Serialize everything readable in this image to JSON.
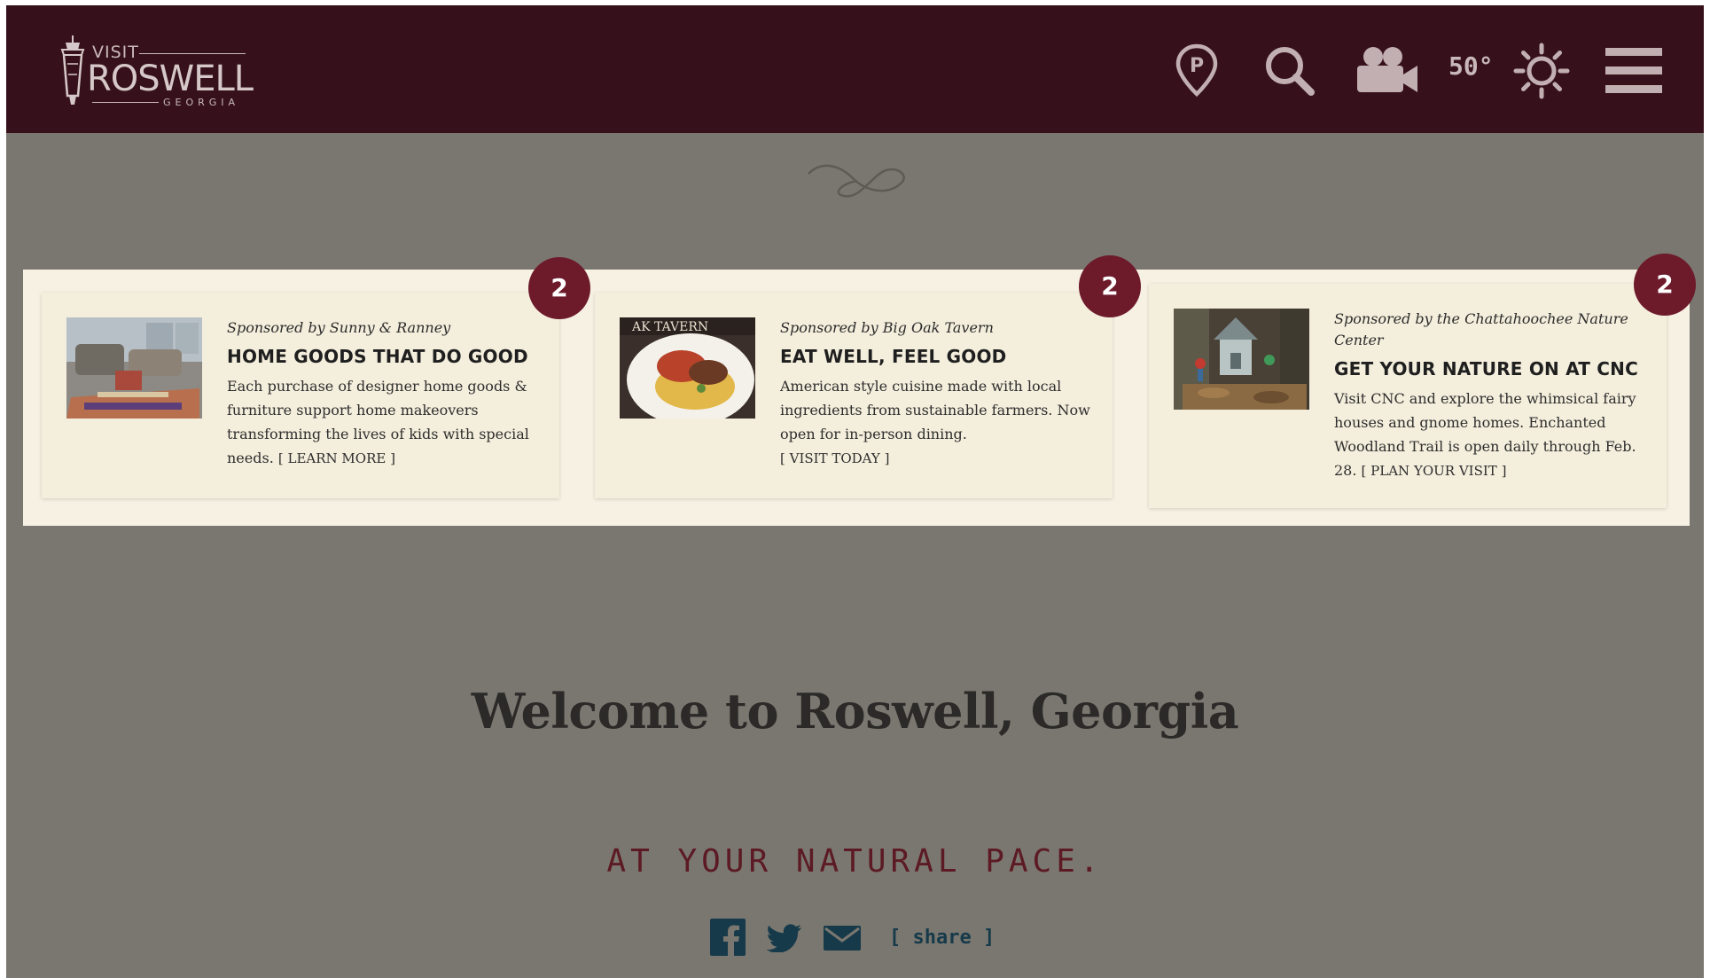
{
  "header": {
    "logo": {
      "visit": "VISIT",
      "name": "ROSWELL",
      "region": "GEORGIA"
    },
    "weather": {
      "temperature": "50°",
      "condition_icon": "sun-icon"
    },
    "icons": [
      "parking-icon",
      "search-icon",
      "video-camera-icon",
      "sun-icon",
      "hamburger-menu-icon"
    ]
  },
  "sponsors": [
    {
      "sponsor": "Sponsored by Sunny & Ranney",
      "title": "HOME GOODS THAT DO GOOD",
      "description": "Each purchase of designer home goods & furniture support home makeovers transforming the lives of kids with special needs.",
      "cta": "[ LEARN MORE ]",
      "badge": "2"
    },
    {
      "sponsor": "Sponsored by Big Oak Tavern",
      "title": "EAT WELL, FEEL GOOD",
      "description": "American style cuisine made with local ingredients from sustainable farmers. Now open for in-person dining.",
      "cta": "[ VISIT TODAY ]",
      "badge": "2"
    },
    {
      "sponsor": "Sponsored by the Chattahoochee Nature Center",
      "title": "GET YOUR NATURE ON AT CNC",
      "description": "Visit CNC and explore the whimsical fairy houses and gnome homes. Enchanted Woodland Trail is open daily through Feb. 28.",
      "cta": "[ PLAN YOUR VISIT ]",
      "badge": "2"
    }
  ],
  "hero": {
    "title": "Welcome to Roswell, Georgia",
    "tagline": "AT YOUR NATURAL PACE."
  },
  "share": {
    "label": "[ share ]",
    "icons": [
      "facebook-icon",
      "twitter-icon",
      "email-icon"
    ]
  },
  "colors": {
    "header_bg": "#36111b",
    "page_overlay": "#7a7770",
    "badge": "#6d1a2b",
    "card_bg": "#f4eedc"
  }
}
